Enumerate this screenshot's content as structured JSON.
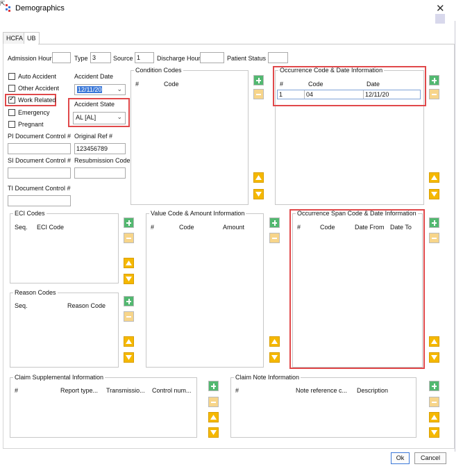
{
  "window": {
    "title": "Demographics",
    "close_glyph": "✕"
  },
  "tabs": [
    {
      "label": "HCFA"
    },
    {
      "label": "UB"
    }
  ],
  "top_row": {
    "admission_hour_label": "Admission Hour",
    "admission_hour_value": "",
    "type_label": "Type",
    "type_value": "3",
    "source_label": "Source",
    "source_value": "1",
    "discharge_hour_label": "Discharge Hour",
    "discharge_hour_value": "",
    "patient_status_label": "Patient Status",
    "patient_status_value": ""
  },
  "checkboxes": [
    {
      "label": "Auto Accident",
      "checked": false
    },
    {
      "label": "Other Accident",
      "checked": false
    },
    {
      "label": "Work Related",
      "checked": true
    },
    {
      "label": "Emergency",
      "checked": false
    },
    {
      "label": "Pregnant",
      "checked": false
    }
  ],
  "accident_date": {
    "label": "Accident Date",
    "value": "12/11/20"
  },
  "accident_state": {
    "label": "Accident State",
    "value": "AL  [AL]"
  },
  "pi_doc_control": {
    "label": "PI Document Control #",
    "value": ""
  },
  "original_ref": {
    "label": "Original Ref #",
    "value": "123456789"
  },
  "si_doc_control": {
    "label": "SI Document Control #",
    "value": ""
  },
  "resubmission_code": {
    "label": "Resubmission Code",
    "value": ""
  },
  "ti_doc_control": {
    "label": "TI Document Control #",
    "value": ""
  },
  "condition_codes": {
    "title": "Condition Codes",
    "columns": [
      "#",
      "Code"
    ]
  },
  "occurrence_codes": {
    "title": "Occurrence Code & Date Information",
    "columns": [
      "#",
      "Code",
      "Date"
    ],
    "rows": [
      {
        "num": "1",
        "code": "04",
        "date": "12/11/20"
      }
    ]
  },
  "eci_codes": {
    "title": "ECI Codes",
    "columns": [
      "Seq.",
      "ECI Code"
    ]
  },
  "value_codes": {
    "title": "Value Code & Amount Information",
    "columns": [
      "#",
      "Code",
      "Amount"
    ]
  },
  "occurrence_span": {
    "title": "Occurrence Span Code & Date Information",
    "columns": [
      "#",
      "Code",
      "Date From",
      "Date To"
    ]
  },
  "reason_codes": {
    "title": "Reason Codes",
    "columns": [
      "Seq.",
      "Reason Code"
    ]
  },
  "claim_supplemental": {
    "title": "Claim Supplemental Information",
    "columns": [
      "#",
      "Report type...",
      "Transmissio...",
      "Control num..."
    ]
  },
  "claim_note": {
    "title": "Claim Note Information",
    "columns": [
      "#",
      "Note reference c...",
      "Description"
    ]
  },
  "buttons": {
    "ok": "Ok",
    "cancel": "Cancel"
  },
  "colors": {
    "highlight": "#e0484a",
    "add": "#52b870",
    "remove": "#f7d58a",
    "arrow": "#f5b800",
    "selection": "#3b78d8"
  },
  "icons": [
    "app-icon",
    "close-icon",
    "checkmark-icon",
    "add-icon",
    "remove-icon",
    "arrow-up-icon",
    "arrow-down-icon",
    "chevron-down-icon"
  ]
}
